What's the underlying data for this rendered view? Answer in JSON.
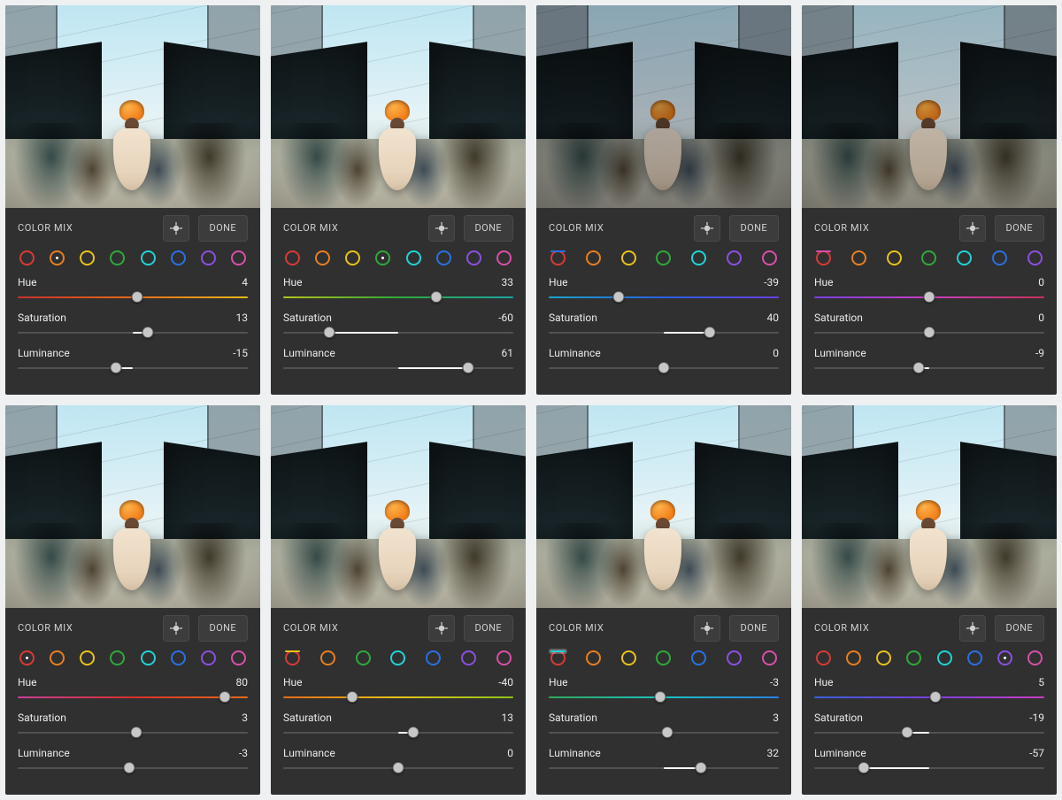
{
  "ui": {
    "panel_title": "COLOR MIX",
    "done_label": "DONE",
    "slider_labels": {
      "hue": "Hue",
      "sat": "Saturation",
      "lum": "Luminance"
    },
    "swatch_colors": [
      "#d73a36",
      "#e67e22",
      "#e6c21a",
      "#2fa83a",
      "#1fd3d3",
      "#2a6fe0",
      "#8a4fe0",
      "#d64fa8"
    ],
    "swatch_names": [
      "red",
      "orange",
      "yellow",
      "green",
      "aqua",
      "blue",
      "purple",
      "magenta"
    ]
  },
  "tiles": [
    {
      "selected": "orange",
      "selected_idx": 1,
      "swatch_style": "dot",
      "hue": 4,
      "sat": 13,
      "lum": -15,
      "hue_grad": "grad-hue-orange",
      "photo_tint": "rgba(0,0,0,0)"
    },
    {
      "selected": "green",
      "selected_idx": 3,
      "swatch_style": "dot",
      "hue": 33,
      "sat": -60,
      "lum": 61,
      "hue_grad": "grad-hue-green",
      "photo_tint": "rgba(0,0,0,0)"
    },
    {
      "selected": "blue",
      "selected_idx": 5,
      "swatch_style": "filldot",
      "hue": -39,
      "sat": 40,
      "lum": 0,
      "hue_grad": "grad-hue-blue",
      "photo_tint": "rgba(15,20,35,0.30)"
    },
    {
      "selected": "magenta",
      "selected_idx": 7,
      "swatch_style": "filldot",
      "hue": 0,
      "sat": 0,
      "lum": -9,
      "hue_grad": "grad-hue-mag",
      "photo_tint": "rgba(10,10,20,0.22)"
    },
    {
      "selected": "red",
      "selected_idx": 0,
      "swatch_style": "dot",
      "hue": 80,
      "sat": 3,
      "lum": -3,
      "hue_grad": "grad-hue-red",
      "photo_tint": "rgba(0,0,0,0)"
    },
    {
      "selected": "yellow",
      "selected_idx": 2,
      "swatch_style": "filldot",
      "hue": -40,
      "sat": 13,
      "lum": 0,
      "hue_grad": "grad-hue-yellow",
      "photo_tint": "rgba(0,0,0,0)"
    },
    {
      "selected": "aqua",
      "selected_idx": 4,
      "swatch_style": "fill",
      "hue": -3,
      "sat": 3,
      "lum": 32,
      "hue_grad": "grad-hue-aqua",
      "photo_tint": "rgba(0,0,0,0)"
    },
    {
      "selected": "purple",
      "selected_idx": 6,
      "swatch_style": "dot",
      "hue": 5,
      "sat": -19,
      "lum": -57,
      "hue_grad": "grad-hue-purple",
      "photo_tint": "rgba(0,0,0,0)"
    }
  ]
}
